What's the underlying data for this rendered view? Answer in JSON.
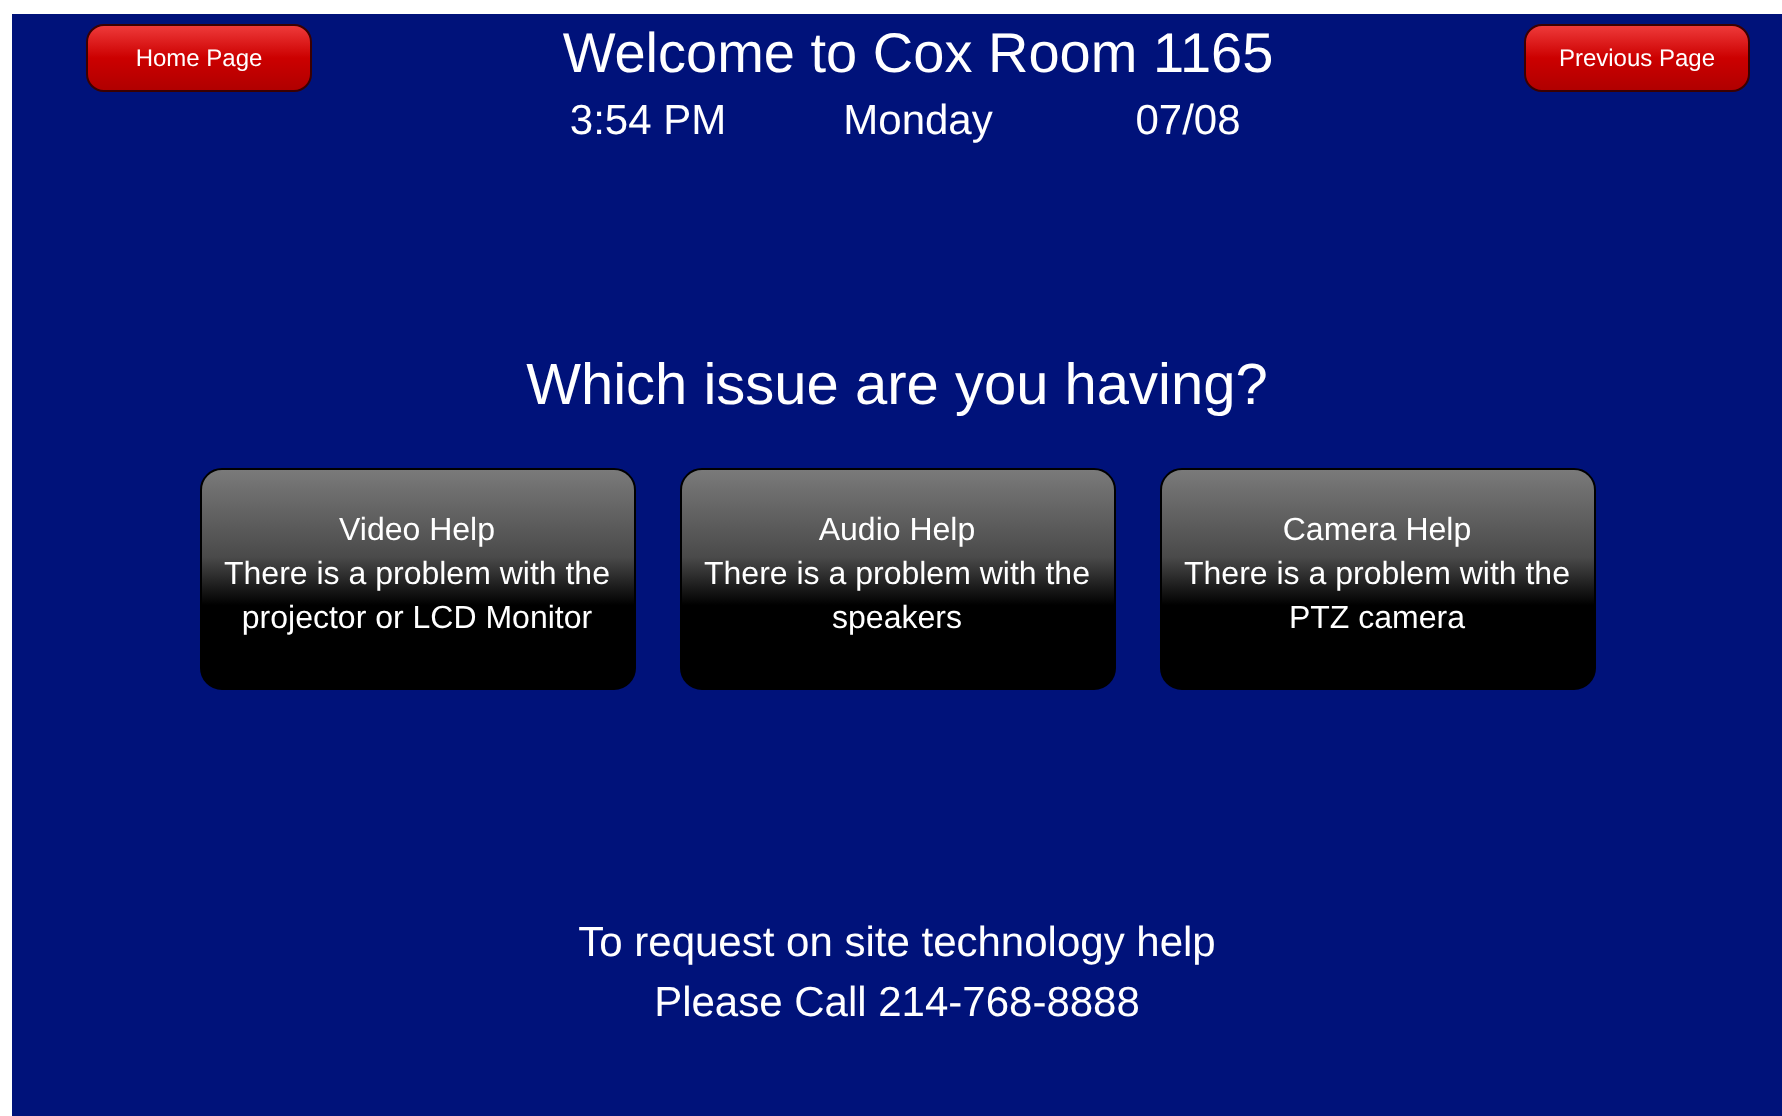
{
  "header": {
    "title": "Welcome to Cox Room 1165",
    "time": "3:54 PM",
    "day": "Monday",
    "date": "07/08"
  },
  "nav_buttons": [
    {
      "label": "Home Page"
    },
    {
      "label": "Previous Page"
    }
  ],
  "question": "Which issue are you having?",
  "issue_buttons": [
    {
      "title": "Video Help",
      "lines": [
        "There is a problem with the",
        "projector or LCD Monitor"
      ]
    },
    {
      "title": "Audio Help",
      "lines": [
        "There is a problem with the",
        "speakers"
      ]
    },
    {
      "title": "Camera Help",
      "lines": [
        "There is a problem with the",
        "PTZ camera"
      ]
    }
  ],
  "footer": {
    "line_1": "To request on site technology help",
    "line_2": "Please Call 214-768-8888"
  }
}
